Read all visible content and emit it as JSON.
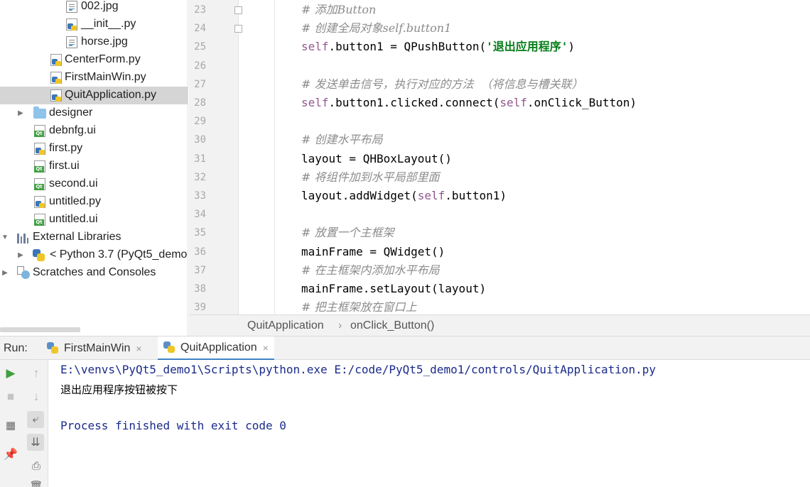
{
  "project_tree": {
    "items": [
      {
        "label": "002.jpg",
        "icon": "image-file-icon"
      },
      {
        "label": "__init__.py",
        "icon": "python-file-icon"
      },
      {
        "label": "horse.jpg",
        "icon": "image-file-icon"
      },
      {
        "label": "CenterForm.py",
        "icon": "python-file-icon"
      },
      {
        "label": "FirstMainWin.py",
        "icon": "python-file-icon"
      },
      {
        "label": "QuitApplication.py",
        "icon": "python-file-icon",
        "selected": true
      },
      {
        "label": "designer",
        "icon": "folder-icon"
      },
      {
        "label": "debnfg.ui",
        "icon": "qt-ui-file-icon"
      },
      {
        "label": "first.py",
        "icon": "python-file-icon"
      },
      {
        "label": "first.ui",
        "icon": "qt-ui-file-icon"
      },
      {
        "label": "second.ui",
        "icon": "qt-ui-file-icon"
      },
      {
        "label": "untitled.py",
        "icon": "python-file-icon"
      },
      {
        "label": "untitled.ui",
        "icon": "qt-ui-file-icon"
      },
      {
        "label": "External Libraries",
        "icon": "library-icon"
      },
      {
        "label": "< Python 3.7 (PyQt5_demo",
        "icon": "python-sdk-icon"
      },
      {
        "label": "Scratches and Consoles",
        "icon": "scratches-icon"
      }
    ]
  },
  "editor": {
    "lines": [
      {
        "num": "23",
        "type": "comment",
        "text": "# 添加Button"
      },
      {
        "num": "24",
        "type": "comment",
        "text": "# 创建全局对象self.button1"
      },
      {
        "num": "25",
        "type": "code",
        "parts": [
          [
            "self",
            "self"
          ],
          [
            "plain",
            ".button1 = QPushButton("
          ],
          [
            "str",
            "'退出应用程序'"
          ],
          [
            "plain",
            ")"
          ]
        ]
      },
      {
        "num": "26",
        "type": "empty"
      },
      {
        "num": "27",
        "type": "comment",
        "text": "# 发送单击信号，执行对应的方法  （将信息与槽关联）"
      },
      {
        "num": "28",
        "type": "code",
        "parts": [
          [
            "self",
            "self"
          ],
          [
            "plain",
            ".button1.clicked.connect("
          ],
          [
            "self",
            "self"
          ],
          [
            "plain",
            ".onClick_Button)"
          ]
        ]
      },
      {
        "num": "29",
        "type": "empty"
      },
      {
        "num": "30",
        "type": "comment",
        "text": "# 创建水平布局"
      },
      {
        "num": "31",
        "type": "code",
        "parts": [
          [
            "plain",
            "layout = QHBoxLayout()"
          ]
        ]
      },
      {
        "num": "32",
        "type": "comment",
        "text": "# 将组件加到水平局部里面"
      },
      {
        "num": "33",
        "type": "code",
        "parts": [
          [
            "plain",
            "layout.addWidget("
          ],
          [
            "self",
            "self"
          ],
          [
            "plain",
            ".button1)"
          ]
        ]
      },
      {
        "num": "34",
        "type": "empty"
      },
      {
        "num": "35",
        "type": "comment",
        "text": "# 放置一个主框架"
      },
      {
        "num": "36",
        "type": "code",
        "parts": [
          [
            "plain",
            "mainFrame = QWidget()"
          ]
        ]
      },
      {
        "num": "37",
        "type": "comment",
        "text": "# 在主框架内添加水平布局"
      },
      {
        "num": "38",
        "type": "code",
        "parts": [
          [
            "plain",
            "mainFrame.setLayout(layout)"
          ]
        ]
      },
      {
        "num": "39",
        "type": "comment",
        "text": "# 把主框架放在窗口上"
      }
    ]
  },
  "breadcrumb": {
    "class_name": "QuitApplication",
    "separator": "›",
    "method_name": "onClick_Button()"
  },
  "run_panel": {
    "label": "Run:",
    "tabs": [
      {
        "label": "FirstMainWin",
        "close": "×"
      },
      {
        "label": "QuitApplication",
        "close": "×",
        "active": true
      }
    ],
    "console": {
      "command": "E:\\venvs\\PyQt5_demo1\\Scripts\\python.exe E:/code/PyQt5_demo1/controls/QuitApplication.py",
      "output": "退出应用程序按钮被按下",
      "finished": "Process finished with exit code 0"
    }
  },
  "colors": {
    "selection": "#d5d5d5",
    "comment": "#8c8c8c",
    "self_keyword": "#94558d",
    "string": "#067d17",
    "console_text": "#1b2a8c",
    "run_green": "#3f9e3f",
    "tab_underline": "#4083c9"
  }
}
